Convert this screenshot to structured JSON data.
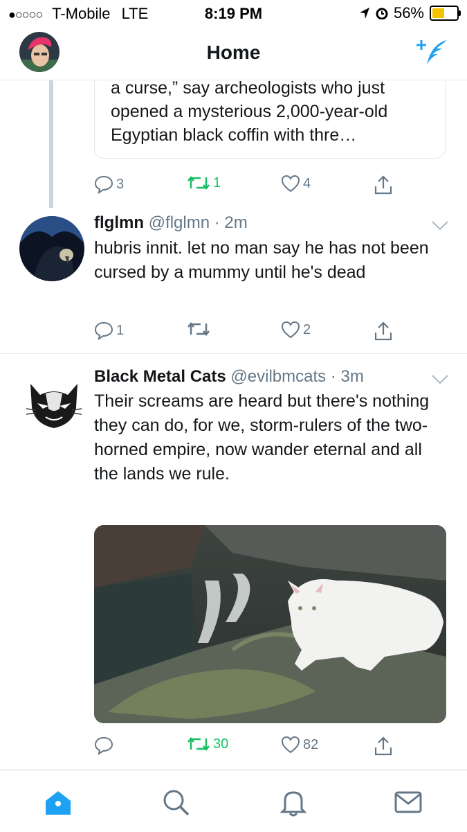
{
  "status_bar": {
    "signal": "●○○○○",
    "carrier": "T-Mobile",
    "network": "LTE",
    "time": "8:19 PM",
    "battery": "56%",
    "battery_level": 0.56
  },
  "nav": {
    "title": "Home"
  },
  "colors": {
    "accent": "#1da1f2",
    "retweet": "#17bf63",
    "muted": "#657786",
    "border": "#e1e8ed"
  },
  "tweets": [
    {
      "card_text": "a curse,” say archeologists who just opened a mysterious 2,000-year-old Egyptian black coffin with thre…",
      "actions": {
        "replies": "3",
        "retweets": "1",
        "likes": "4"
      }
    },
    {
      "name": "flglmn",
      "handle": "@flglmn",
      "time": "· 2m",
      "text": "hubris innit. let no man say he has not been cursed by a mummy until he's dead",
      "actions": {
        "replies": "1",
        "retweets": "",
        "likes": "2"
      }
    },
    {
      "name": "Black Metal Cats",
      "handle": "@evilbmcats",
      "time": "· 3m",
      "text": "Their screams are heard but there's nothing they can do, for we, storm-rulers of the two-horned empire, now wander eternal and all the lands we rule.",
      "actions": {
        "replies": "",
        "retweets": "30",
        "likes": "82"
      }
    }
  ],
  "icons": [
    "location-arrow-icon",
    "alarm-icon",
    "compose-tweet-icon",
    "reply-icon",
    "retweet-icon",
    "like-icon",
    "share-icon",
    "chevron-down-icon",
    "home-icon",
    "search-icon",
    "notifications-icon",
    "messages-icon"
  ]
}
